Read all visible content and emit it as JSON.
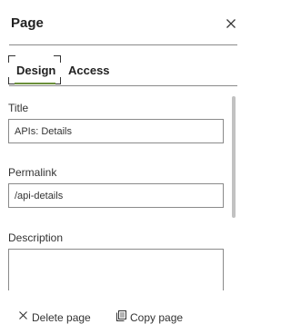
{
  "panel": {
    "title": "Page"
  },
  "tabs": [
    {
      "label": "Design",
      "active": true
    },
    {
      "label": "Access",
      "active": false
    }
  ],
  "fields": {
    "title": {
      "label": "Title",
      "value": "APIs: Details"
    },
    "permalink": {
      "label": "Permalink",
      "value": "/api-details"
    },
    "description": {
      "label": "Description",
      "value": ""
    }
  },
  "footer": {
    "delete_label": "Delete page",
    "copy_label": "Copy page"
  },
  "colors": {
    "active_tab_underline": "#6b8f3a",
    "border": "#8a8a8a",
    "scrollbar": "#c2c2c2"
  },
  "icons": {
    "close": "close-icon",
    "delete": "close-icon",
    "copy": "copy-icon"
  }
}
